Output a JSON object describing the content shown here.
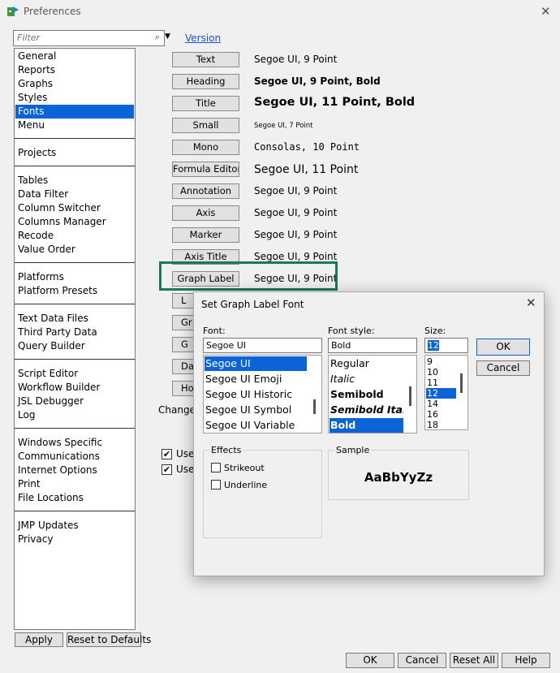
{
  "window": {
    "title": "Preferences",
    "close_glyph": "✕"
  },
  "filter": {
    "placeholder": "Filter",
    "search_glyph": "⌕",
    "dropdown_glyph": "▼",
    "version_link": "Version"
  },
  "categories": [
    [
      "General",
      "Reports",
      "Graphs",
      "Styles",
      "Fonts",
      "Menu"
    ],
    [
      "Projects"
    ],
    [
      "Tables",
      "Data Filter",
      "Column Switcher",
      "Columns Manager",
      "Recode",
      "Value Order"
    ],
    [
      "Platforms",
      "Platform Presets"
    ],
    [
      "Text Data Files",
      "Third Party Data",
      "Query Builder"
    ],
    [
      "Script Editor",
      "Workflow Builder",
      "JSL Debugger",
      "Log"
    ],
    [
      "Windows Specific",
      "Communications",
      "Internet Options",
      "Print",
      "File Locations"
    ],
    [
      "JMP Updates",
      "Privacy"
    ]
  ],
  "selected_category": "Fonts",
  "font_rows": [
    {
      "button": "Text",
      "desc": "Segoe UI, 9 Point"
    },
    {
      "button": "Heading",
      "desc": "Segoe UI, 9 Point, Bold"
    },
    {
      "button": "Title",
      "desc": "Segoe UI, 11 Point, Bold"
    },
    {
      "button": "Small",
      "desc": "Segoe UI, 7 Point"
    },
    {
      "button": "Mono",
      "desc": "Consolas, 10 Point"
    },
    {
      "button": "Formula Editor",
      "desc": "Segoe UI, 11 Point"
    },
    {
      "button": "Annotation",
      "desc": "Segoe UI, 9 Point"
    },
    {
      "button": "Axis",
      "desc": "Segoe UI, 9 Point"
    },
    {
      "button": "Marker",
      "desc": "Segoe UI, 9 Point"
    },
    {
      "button": "Axis Title",
      "desc": "Segoe UI, 9 Point"
    },
    {
      "button": "Graph Label",
      "desc": "Segoe UI, 9 Point"
    }
  ],
  "hidden_buttons": [
    "L",
    "Gr",
    "G",
    "Da",
    "Ho"
  ],
  "change_text": "Change",
  "checkbox_labels": [
    "Use",
    "Use"
  ],
  "bottom": {
    "apply": "Apply",
    "reset_defaults": "Reset to Defaults",
    "ok": "OK",
    "cancel": "Cancel",
    "reset_all": "Reset All",
    "help": "Help"
  },
  "dialog": {
    "title": "Set Graph Label Font",
    "close_glyph": "✕",
    "font_label": "Font:",
    "font_value": "Segoe UI",
    "fonts": [
      "Segoe UI",
      "Segoe UI Emoji",
      "Segoe UI Historic",
      "Segoe UI Symbol",
      "Segoe UI Variable"
    ],
    "style_label": "Font style:",
    "style_value": "Bold",
    "styles": [
      "Regular",
      "Italic",
      "Semibold",
      "Semibold Italic",
      "Bold"
    ],
    "size_label": "Size:",
    "size_value": "12",
    "sizes": [
      "9",
      "10",
      "11",
      "12",
      "14",
      "16",
      "18"
    ],
    "ok": "OK",
    "cancel": "Cancel",
    "effects_label": "Effects",
    "strikeout": "Strikeout",
    "underline": "Underline",
    "sample_label": "Sample",
    "sample_text": "AaBbYyZz"
  }
}
